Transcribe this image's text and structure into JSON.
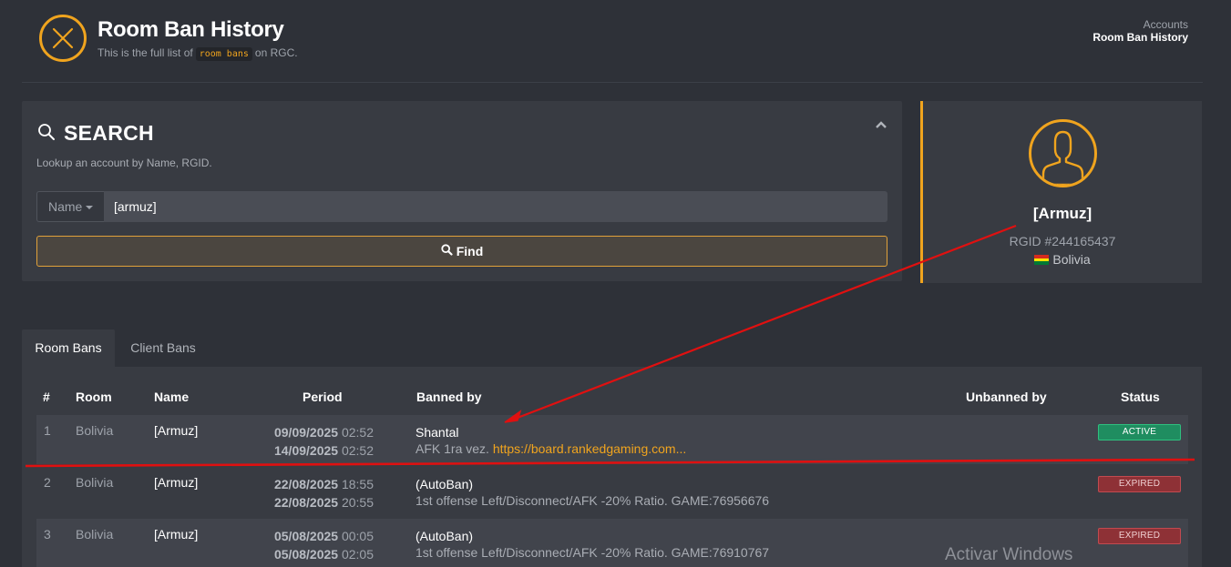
{
  "header": {
    "title": "Room Ban History",
    "subtitle_prefix": "This is the full list of",
    "subtitle_code": "room bans",
    "subtitle_suffix": "on RGC.",
    "icon": "close-circle-icon"
  },
  "breadcrumb": {
    "parent": "Accounts",
    "current": "Room Ban History"
  },
  "search": {
    "title": "SEARCH",
    "description": "Lookup an account by Name, RGID.",
    "select_value": "Name",
    "input_value": "[armuz]",
    "find_label": "Find"
  },
  "profile": {
    "name": "[Armuz]",
    "rgid": "RGID #244165437",
    "country": "Bolivia",
    "flag_colors": [
      "#d52b1e",
      "#f9e300",
      "#007934"
    ]
  },
  "tabs": [
    {
      "label": "Room Bans",
      "active": true
    },
    {
      "label": "Client Bans",
      "active": false
    }
  ],
  "table": {
    "columns": [
      "#",
      "Room",
      "Name",
      "Period",
      "Banned by",
      "Unbanned by",
      "Status"
    ],
    "rows": [
      {
        "num": "1",
        "room": "Bolivia",
        "name": "[Armuz]",
        "start_date": "09/09/2025",
        "start_time": "02:52",
        "end_date": "14/09/2025",
        "end_time": "02:52",
        "banned_by": "Shantal",
        "reason_text": "AFK 1ra vez.",
        "reason_link": "https://board.rankedgaming.com...",
        "unbanned_by": "",
        "status": "ACTIVE"
      },
      {
        "num": "2",
        "room": "Bolivia",
        "name": "[Armuz]",
        "start_date": "22/08/2025",
        "start_time": "18:55",
        "end_date": "22/08/2025",
        "end_time": "20:55",
        "banned_by": "(AutoBan)",
        "reason_text": "1st offense Left/Disconnect/AFK -20% Ratio. GAME:76956676",
        "reason_link": "",
        "unbanned_by": "",
        "status": "EXPIRED"
      },
      {
        "num": "3",
        "room": "Bolivia",
        "name": "[Armuz]",
        "start_date": "05/08/2025",
        "start_time": "00:05",
        "end_date": "05/08/2025",
        "end_time": "02:05",
        "banned_by": "(AutoBan)",
        "reason_text": "1st offense Left/Disconnect/AFK -20% Ratio. GAME:76910767",
        "reason_link": "",
        "unbanned_by": "",
        "status": "EXPIRED"
      }
    ]
  },
  "watermark": "Activar Windows",
  "colors": {
    "accent": "#f0a41e",
    "background": "#2e3138",
    "panel": "#383b42",
    "active_badge": "#1f8d60",
    "expired_badge": "#8e3136",
    "annotation": "#e01010"
  }
}
